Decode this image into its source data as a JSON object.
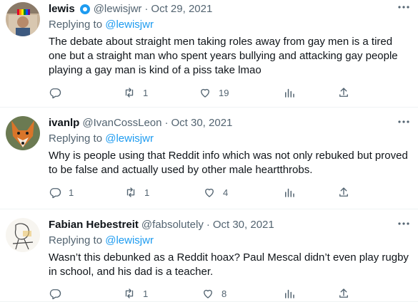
{
  "tweets": [
    {
      "name": "lewis",
      "verified": true,
      "handle": "@lewisjwr",
      "dot": "·",
      "date": "Oct 29, 2021",
      "replying_prefix": "Replying to",
      "replying_to": "@lewisjwr",
      "text": "The debate about straight men taking roles away from gay men is a tired one but a straight man who spent years bullying and attacking gay people playing a gay man is kind of a piss take lmao",
      "replies": "",
      "retweets": "1",
      "likes": "19",
      "avatar": "avatar-photo-rainbow-flag"
    },
    {
      "name": "ivanlp",
      "verified": false,
      "handle": "@IvanCossLeon",
      "dot": "·",
      "date": "Oct 30, 2021",
      "replying_prefix": "Replying to",
      "replying_to": "@lewisjwr",
      "text": "Why is people using that Reddit info which was not only rebuked but proved to be false and actually used by other male heartthrobs.",
      "replies": "1",
      "retweets": "1",
      "likes": "4",
      "avatar": "avatar-fox"
    },
    {
      "name": "Fabian Hebestreit",
      "verified": false,
      "handle": "@fabsolutely",
      "dot": "·",
      "date": "Oct 30, 2021",
      "replying_prefix": "Replying to",
      "replying_to": "@lewisjwr",
      "text": "Wasn’t this debunked as a Reddit hoax? Paul Mescal didn’t even play rugby in school, and his dad is a teacher.",
      "replies": "",
      "retweets": "1",
      "likes": "8",
      "avatar": "avatar-sketch-drawing"
    }
  ],
  "colors": {
    "text": "#0f1419",
    "secondary": "#536471",
    "link": "#1d9bf0",
    "border": "#eff3f4"
  },
  "icons": [
    "more-icon",
    "reply-icon",
    "retweet-icon",
    "like-icon",
    "views-icon",
    "share-icon",
    "verified-badge-icon"
  ]
}
